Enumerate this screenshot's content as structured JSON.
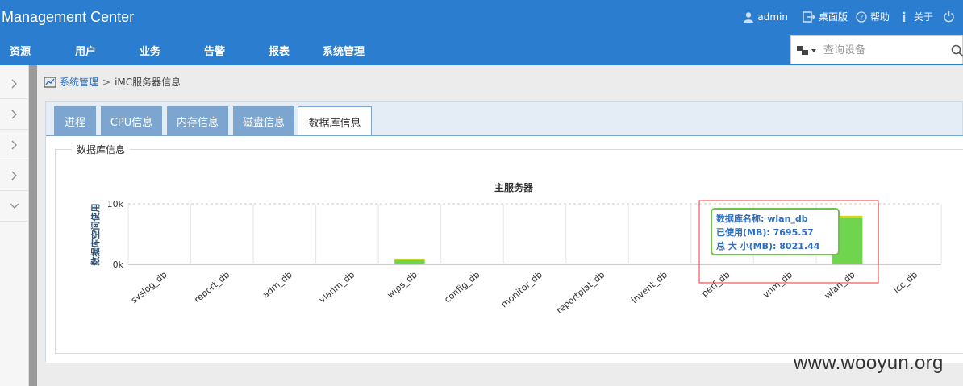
{
  "app": {
    "title": "Management Center"
  },
  "topbar": {
    "user": "admin",
    "desktop": "桌面版",
    "help": "帮助",
    "about": "关于"
  },
  "nav": {
    "items": [
      "资源",
      "用户",
      "业务",
      "告警",
      "报表",
      "系统管理"
    ]
  },
  "search": {
    "placeholder": "查询设备"
  },
  "breadcrumb": {
    "parent": "系统管理",
    "separator": ">",
    "current": "iMC服务器信息"
  },
  "tabs": [
    "进程",
    "CPU信息",
    "内存信息",
    "磁盘信息",
    "数据库信息"
  ],
  "active_tab": 4,
  "section": {
    "legend": "数据库信息"
  },
  "chart_data": {
    "type": "bar",
    "title": "主服务器",
    "ylabel": "数据库空间使用",
    "xlabel": "",
    "ylim": [
      0,
      10000
    ],
    "yticks": [
      "0k",
      "10k"
    ],
    "categories": [
      "syslog_db",
      "report_db",
      "adm_db",
      "vlanm_db",
      "wips_db",
      "config_db",
      "monitor_db",
      "reportplat_db",
      "invent_db",
      "perf_db",
      "vnm_db",
      "wlan_db",
      "icc_db"
    ],
    "series": [
      {
        "values": [
          0,
          0,
          0,
          0,
          700,
          0,
          0,
          0,
          0,
          0,
          0,
          7695.57,
          0
        ]
      },
      {
        "values": [
          0,
          0,
          0,
          0,
          950,
          0,
          0,
          0,
          0,
          0,
          0,
          8021.44,
          0
        ]
      }
    ],
    "colors": {
      "used": "#6fd44e",
      "total": "#d4d41a"
    },
    "tooltip": {
      "name_label": "数据库名称:",
      "name": "wlan_db",
      "used_label": "已使用(MB):",
      "used": "7695.57",
      "total_label": "总 大 小(MB):",
      "total": "8021.44"
    }
  },
  "watermark": "www.wooyun.org"
}
